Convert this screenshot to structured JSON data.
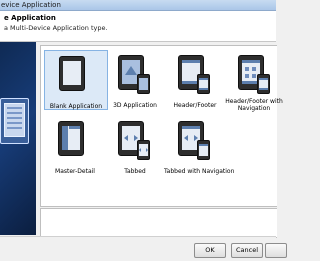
{
  "window": {
    "title": "evice Application"
  },
  "header": {
    "title": "e Application",
    "subtitle": "a Multi-Device Application type."
  },
  "templates": [
    {
      "label": "Blank Application",
      "selected": true
    },
    {
      "label": "3D Application",
      "selected": false
    },
    {
      "label": "Header/Footer",
      "selected": false
    },
    {
      "label": "Header/Footer with Navigation",
      "selected": false
    },
    {
      "label": "Master-Detail",
      "selected": false
    },
    {
      "label": "Tabbed",
      "selected": false
    },
    {
      "label": "Tabbed with Navigation",
      "selected": false
    }
  ],
  "buttons": {
    "ok": "OK",
    "cancel": "Cancel",
    "help": ""
  },
  "colors": {
    "accent": "#5d7fae",
    "selection": "#dce9f7",
    "panel": "#173c78"
  }
}
